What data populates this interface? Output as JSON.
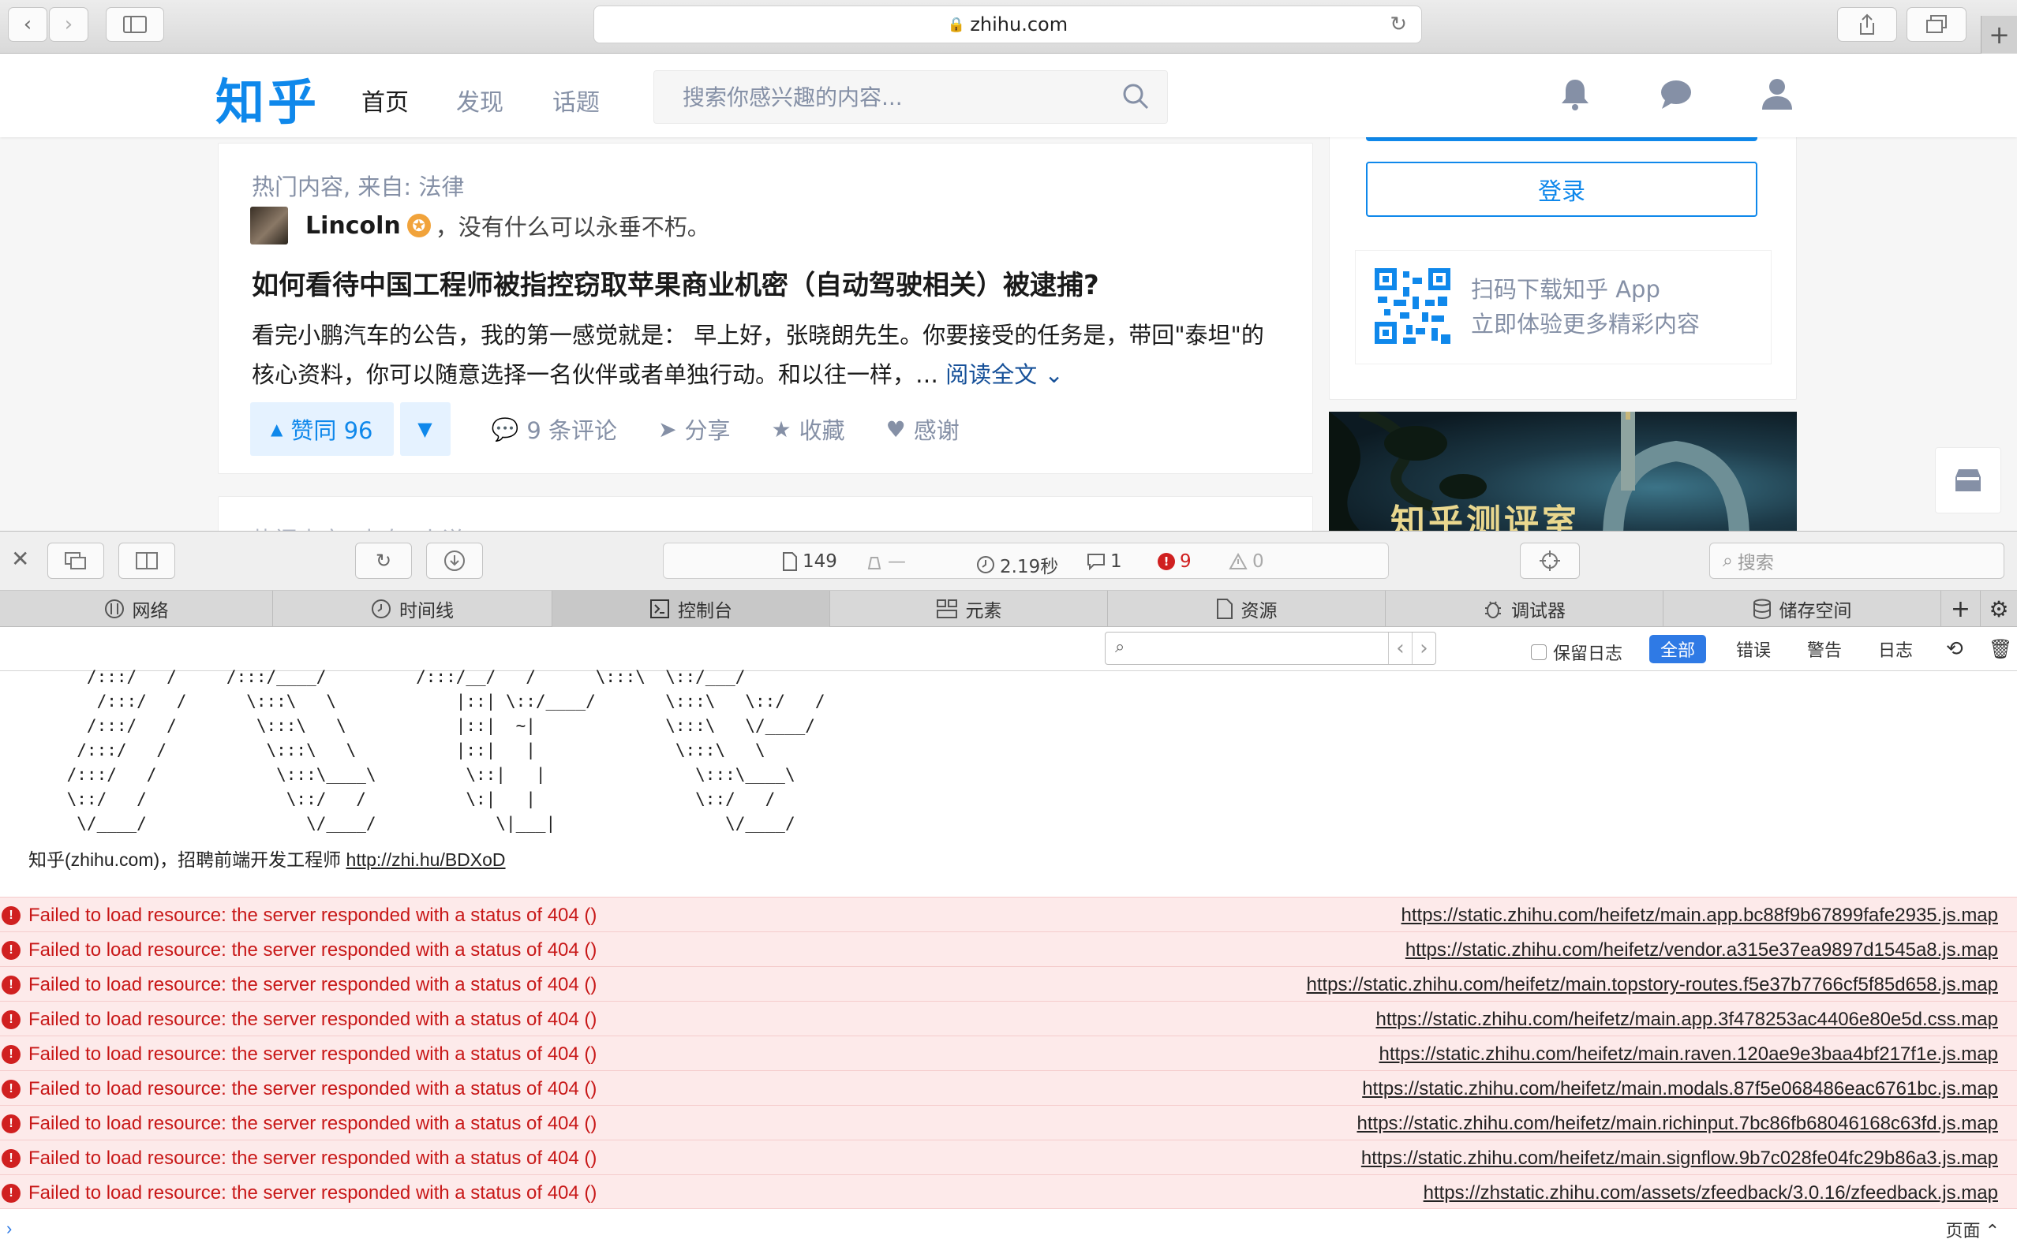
{
  "browser": {
    "url": "zhihu.com"
  },
  "zhihu": {
    "logo": "知乎",
    "nav": [
      "首页",
      "发现",
      "话题"
    ],
    "search_placeholder": "搜索你感兴趣的内容...",
    "feed": {
      "label": "热门内容, 来自: 法律",
      "author": "Lincoln",
      "author_bio": "，没有什么可以永垂不朽。",
      "question": "如何看待中国工程师被指控窃取苹果商业机密（自动驾驶相关）被逮捕?",
      "excerpt": "看完小鹏汽车的公告，我的第一感觉就是： 早上好，张晓朗先生。你要接受的任务是，带回\"泰坦\"的核心资料，你可以随意选择一名伙伴或者单独行动。和以往一样，…",
      "read_more": "阅读全文",
      "vote_label": "赞同 96",
      "comments": "9 条评论",
      "share": "分享",
      "favorite": "收藏",
      "thanks": "感谢",
      "next_label": "热门内容, 来自: 小说"
    },
    "sidebar": {
      "login": "登录",
      "qr_line1": "扫码下载知乎 App",
      "qr_line2": "立即体验更多精彩内容",
      "banner_text": "知乎测评室"
    }
  },
  "inspector": {
    "status": {
      "resources": "149",
      "load_size": "—",
      "load_time": "2.19秒",
      "logs": "1",
      "errors": "9",
      "warnings": "0"
    },
    "search_placeholder": "搜索",
    "tabs": [
      "网络",
      "时间线",
      "控制台",
      "元素",
      "资源",
      "调试器",
      "储存空间"
    ],
    "active_tab": "控制台",
    "filter": {
      "preserve_log": "保留日志",
      "levels": [
        "全部",
        "错误",
        "警告",
        "日志"
      ]
    },
    "console": {
      "ascii_art": "   /:::/   /     /:::/____/         /:::/__/   /      \\:::\\  \\::/___/\n    /:::/   /      \\:::\\   \\            |::| \\::/____/       \\:::\\   \\::/   /\n   /:::/   /        \\:::\\   \\           |::|  ~|             \\:::\\   \\/____/\n  /:::/   /          \\:::\\   \\          |::|   |              \\:::\\   \\\n /:::/   /            \\:::\\____\\         \\::|   |               \\:::\\____\\\n \\::/   /              \\::/   /          \\:|   |                \\::/   /\n  \\/____/                \\/____/            \\|___|                 \\/____/",
      "recruit_text": "知乎(zhihu.com)，招聘前端开发工程师 ",
      "recruit_link": "http://zhi.hu/BDXoD",
      "errors": [
        {
          "message": "Failed to load resource: the server responded with a status of 404 ()",
          "source": "https://static.zhihu.com/heifetz/main.app.bc88f9b67899fafe2935.js.map"
        },
        {
          "message": "Failed to load resource: the server responded with a status of 404 ()",
          "source": "https://static.zhihu.com/heifetz/vendor.a315e37ea9897d1545a8.js.map"
        },
        {
          "message": "Failed to load resource: the server responded with a status of 404 ()",
          "source": "https://static.zhihu.com/heifetz/main.topstory-routes.f5e37b7766cf5f85d658.js.map"
        },
        {
          "message": "Failed to load resource: the server responded with a status of 404 ()",
          "source": "https://static.zhihu.com/heifetz/main.app.3f478253ac4406e80e5d.css.map"
        },
        {
          "message": "Failed to load resource: the server responded with a status of 404 ()",
          "source": "https://static.zhihu.com/heifetz/main.raven.120ae9e3baa4bf217f1e.js.map"
        },
        {
          "message": "Failed to load resource: the server responded with a status of 404 ()",
          "source": "https://static.zhihu.com/heifetz/main.modals.87f5e068486eac6761bc.js.map"
        },
        {
          "message": "Failed to load resource: the server responded with a status of 404 ()",
          "source": "https://static.zhihu.com/heifetz/main.richinput.7bc86fb68046168c63fd.js.map"
        },
        {
          "message": "Failed to load resource: the server responded with a status of 404 ()",
          "source": "https://static.zhihu.com/heifetz/main.signflow.9b7c028fe04fc29b86a3.js.map"
        },
        {
          "message": "Failed to load resource: the server responded with a status of 404 ()",
          "source": "https://zhstatic.zhihu.com/assets/zfeedback/3.0.16/zfeedback.js.map"
        }
      ],
      "context": "页面 ⌃"
    }
  },
  "colors": {
    "zhihu_blue": "#0f88eb",
    "error_red": "#c81818",
    "error_bg": "#fdeaea",
    "inspector_blue": "#2f7ae5"
  }
}
